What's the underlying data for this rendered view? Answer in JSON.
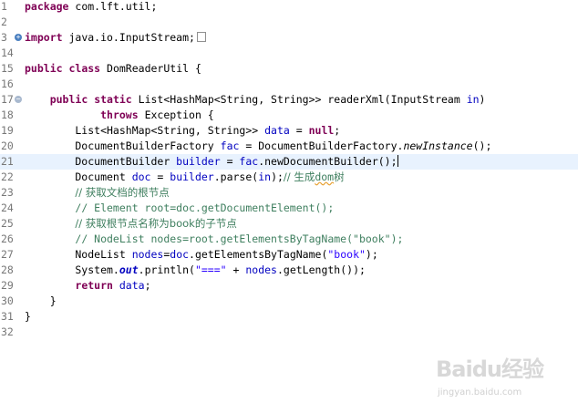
{
  "editor": {
    "lines": [
      {
        "num": "1",
        "tokens": [
          {
            "t": "package",
            "c": "kw"
          },
          {
            "t": " com.lft.util;"
          }
        ]
      },
      {
        "num": "2",
        "tokens": []
      },
      {
        "num": "3",
        "fold": "plus",
        "tokens": [
          {
            "t": "import",
            "c": "kw"
          },
          {
            "t": " java.io.InputStream;"
          },
          {
            "box": true
          }
        ]
      },
      {
        "num": "14",
        "tokens": []
      },
      {
        "num": "15",
        "tokens": [
          {
            "t": "public",
            "c": "kw"
          },
          {
            "t": " "
          },
          {
            "t": "class",
            "c": "kw"
          },
          {
            "t": " DomReaderUtil {"
          }
        ]
      },
      {
        "num": "16",
        "tokens": []
      },
      {
        "num": "17",
        "fold": "minus",
        "tokens": [
          {
            "t": "    "
          },
          {
            "t": "public",
            "c": "kw"
          },
          {
            "t": " "
          },
          {
            "t": "static",
            "c": "kw"
          },
          {
            "t": " List<HashMap<String, String>> readerXml(InputStream "
          },
          {
            "t": "in",
            "c": "fd"
          },
          {
            "t": ")"
          }
        ]
      },
      {
        "num": "18",
        "tokens": [
          {
            "t": "            "
          },
          {
            "t": "throws",
            "c": "kw"
          },
          {
            "t": " Exception {"
          }
        ]
      },
      {
        "num": "19",
        "tokens": [
          {
            "t": "        List<HashMap<String, String>> "
          },
          {
            "t": "data",
            "c": "fd"
          },
          {
            "t": " = "
          },
          {
            "t": "null",
            "c": "kw"
          },
          {
            "t": ";"
          }
        ]
      },
      {
        "num": "20",
        "tokens": [
          {
            "t": "        DocumentBuilderFactory "
          },
          {
            "t": "fac",
            "c": "fd"
          },
          {
            "t": " = DocumentBuilderFactory."
          },
          {
            "t": "newInstance",
            "c": "it"
          },
          {
            "t": "();"
          }
        ]
      },
      {
        "num": "21",
        "current": true,
        "tokens": [
          {
            "t": "        DocumentBuilder "
          },
          {
            "t": "builder",
            "c": "fd"
          },
          {
            "t": " = "
          },
          {
            "t": "fac",
            "c": "fd"
          },
          {
            "t": ".newDocumentBuilder();"
          },
          {
            "caret": true
          }
        ]
      },
      {
        "num": "22",
        "tokens": [
          {
            "t": "        Document "
          },
          {
            "t": "doc",
            "c": "fd"
          },
          {
            "t": " = "
          },
          {
            "t": "builder",
            "c": "fd"
          },
          {
            "t": ".parse("
          },
          {
            "t": "in",
            "c": "fd"
          },
          {
            "t": ");"
          },
          {
            "t": "// 生成",
            "c": "cm cjk"
          },
          {
            "t": "dom",
            "c": "cm squiggle"
          },
          {
            "t": "树",
            "c": "cm cjk"
          }
        ]
      },
      {
        "num": "23",
        "tokens": [
          {
            "t": "        "
          },
          {
            "t": "// 获取文档的根节点",
            "c": "cm cjk"
          }
        ]
      },
      {
        "num": "24",
        "tokens": [
          {
            "t": "        "
          },
          {
            "t": "// Element root=doc.getDocumentElement();",
            "c": "cm"
          }
        ]
      },
      {
        "num": "25",
        "tokens": [
          {
            "t": "        "
          },
          {
            "t": "// 获取根节点名称为book的子节点",
            "c": "cm cjk"
          }
        ]
      },
      {
        "num": "26",
        "tokens": [
          {
            "t": "        "
          },
          {
            "t": "// NodeList nodes=root.getElementsByTagName(\"book\");",
            "c": "cm"
          }
        ]
      },
      {
        "num": "27",
        "tokens": [
          {
            "t": "        NodeList "
          },
          {
            "t": "nodes",
            "c": "fd"
          },
          {
            "t": "="
          },
          {
            "t": "doc",
            "c": "fd"
          },
          {
            "t": ".getElementsByTagName("
          },
          {
            "t": "\"book\"",
            "c": "st"
          },
          {
            "t": ");"
          }
        ]
      },
      {
        "num": "28",
        "tokens": [
          {
            "t": "        System."
          },
          {
            "t": "out",
            "c": "fd it kwb"
          },
          {
            "t": ".println("
          },
          {
            "t": "\"===\"",
            "c": "st"
          },
          {
            "t": " + "
          },
          {
            "t": "nodes",
            "c": "fd"
          },
          {
            "t": ".getLength());"
          }
        ]
      },
      {
        "num": "29",
        "tokens": [
          {
            "t": "        "
          },
          {
            "t": "return",
            "c": "kw"
          },
          {
            "t": " "
          },
          {
            "t": "data",
            "c": "fd"
          },
          {
            "t": ";"
          }
        ]
      },
      {
        "num": "30",
        "tokens": [
          {
            "t": "    }"
          }
        ]
      },
      {
        "num": "31",
        "tokens": [
          {
            "t": "}"
          }
        ]
      },
      {
        "num": "32",
        "tokens": []
      }
    ]
  },
  "watermark": {
    "logo": "Baidu经验",
    "url": "jingyan.baidu.com"
  }
}
